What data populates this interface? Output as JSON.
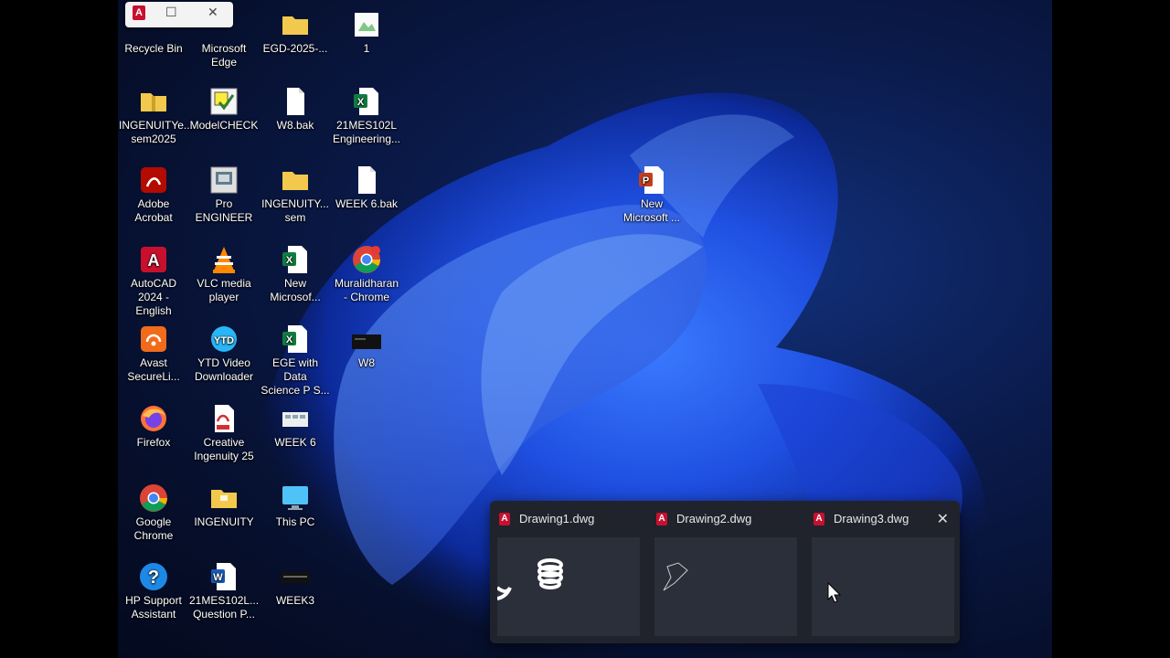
{
  "desktop": {
    "icons": [
      {
        "label": "Recycle Bin",
        "icon": "recycle-bin-icon"
      },
      {
        "label": "Microsoft\nEdge",
        "icon": "edge-icon"
      },
      {
        "label": "EGD-2025-...",
        "icon": "folder-icon"
      },
      {
        "label": "1",
        "icon": "image-file-icon"
      },
      {
        "label": "INGENUITYe...\nsem2025",
        "icon": "zip-folder-icon"
      },
      {
        "label": "ModelCHECK",
        "icon": "modelcheck-icon"
      },
      {
        "label": "W8.bak",
        "icon": "file-icon"
      },
      {
        "label": "21MES102L\nEngineering...",
        "icon": "excel-icon"
      },
      {
        "label": "Adobe\nAcrobat",
        "icon": "acrobat-icon"
      },
      {
        "label": "Pro\nENGINEER",
        "icon": "proengineer-icon"
      },
      {
        "label": "INGENUITY...\nsem",
        "icon": "folder-icon"
      },
      {
        "label": "WEEK 6.bak",
        "icon": "file-icon"
      },
      {
        "label": "AutoCAD\n2024 - English",
        "icon": "autocad-icon"
      },
      {
        "label": "VLC media\nplayer",
        "icon": "vlc-icon"
      },
      {
        "label": "New\nMicrosof...",
        "icon": "excel-icon"
      },
      {
        "label": "Muralidharan\n- Chrome",
        "icon": "chrome-icon"
      },
      {
        "label": "Avast\nSecureLi...",
        "icon": "avast-icon"
      },
      {
        "label": "YTD Video\nDownloader",
        "icon": "ytd-icon"
      },
      {
        "label": "EGE with Data\nScience P S...",
        "icon": "excel-icon"
      },
      {
        "label": "W8",
        "icon": "dwg-thumbnail-icon"
      },
      {
        "label": "Firefox",
        "icon": "firefox-icon"
      },
      {
        "label": "Creative\nIngenuity 25",
        "icon": "pdf-icon"
      },
      {
        "label": "WEEK 6",
        "icon": "image-file-icon"
      },
      {
        "label": "Google\nChrome",
        "icon": "chrome-icon"
      },
      {
        "label": "INGENUITY",
        "icon": "folder-icon"
      },
      {
        "label": "This PC",
        "icon": "monitor-icon"
      },
      {
        "label": "HP Support\nAssistant",
        "icon": "help-icon"
      },
      {
        "label": "21MES102L...\nQuestion P...",
        "icon": "word-icon"
      },
      {
        "label": "WEEK3",
        "icon": "dwg-thumbnail-icon"
      },
      {
        "label": "New\nMicrosoft ...",
        "icon": "powerpoint-icon"
      }
    ]
  },
  "mini_window": {
    "app_letter": "A",
    "maximize": "☐",
    "close": "✕"
  },
  "taskbar_preview": {
    "app_letter": "A",
    "thumbnails": [
      {
        "title": "Drawing1.dwg"
      },
      {
        "title": "Drawing2.dwg"
      },
      {
        "title": "Drawing3.dwg"
      }
    ],
    "close_symbol": "✕"
  },
  "colors": {
    "autocad_red": "#c8102e",
    "preview_bg": "#20232c"
  }
}
